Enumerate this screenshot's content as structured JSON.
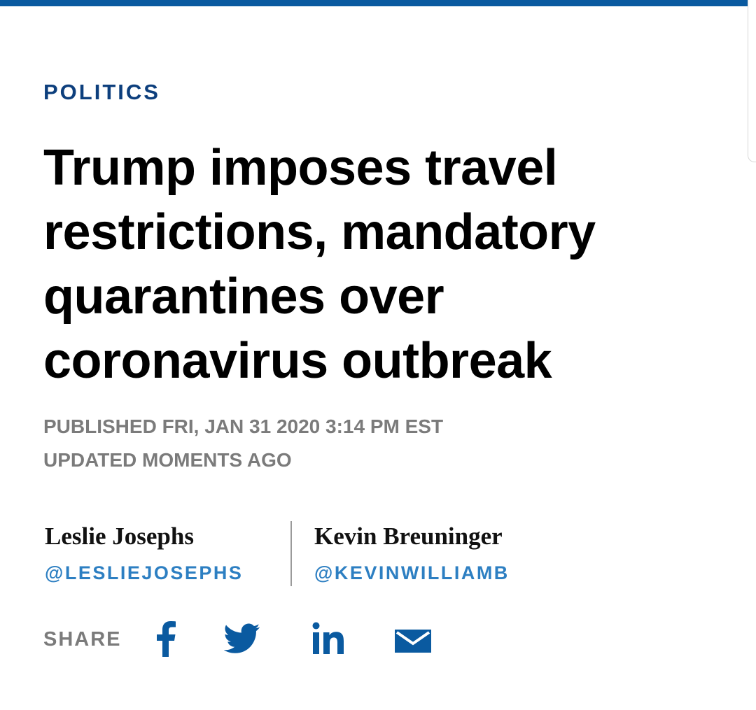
{
  "colors": {
    "top_bar": "#0a5aa0",
    "section": "#0d3f7d",
    "headline": "#000000",
    "meta": "#7b7b7b",
    "handle": "#2d7fc2",
    "icon": "#0a5aa0"
  },
  "article": {
    "section": "POLITICS",
    "headline_lines": [
      "Trump imposes travel",
      "restrictions, mandatory",
      "quarantines over",
      "coronavirus outbreak"
    ],
    "published": "PUBLISHED FRI, JAN 31 2020 3:14 PM EST",
    "updated": "UPDATED MOMENTS AGO"
  },
  "authors": [
    {
      "name": "Leslie Josephs",
      "handle": "@LESLIEJOSEPHS"
    },
    {
      "name": "Kevin Breuninger",
      "handle": "@KEVINWILLIAMB"
    }
  ],
  "share": {
    "label": "SHARE",
    "icons": [
      "facebook-icon",
      "twitter-icon",
      "linkedin-icon",
      "email-icon"
    ]
  }
}
